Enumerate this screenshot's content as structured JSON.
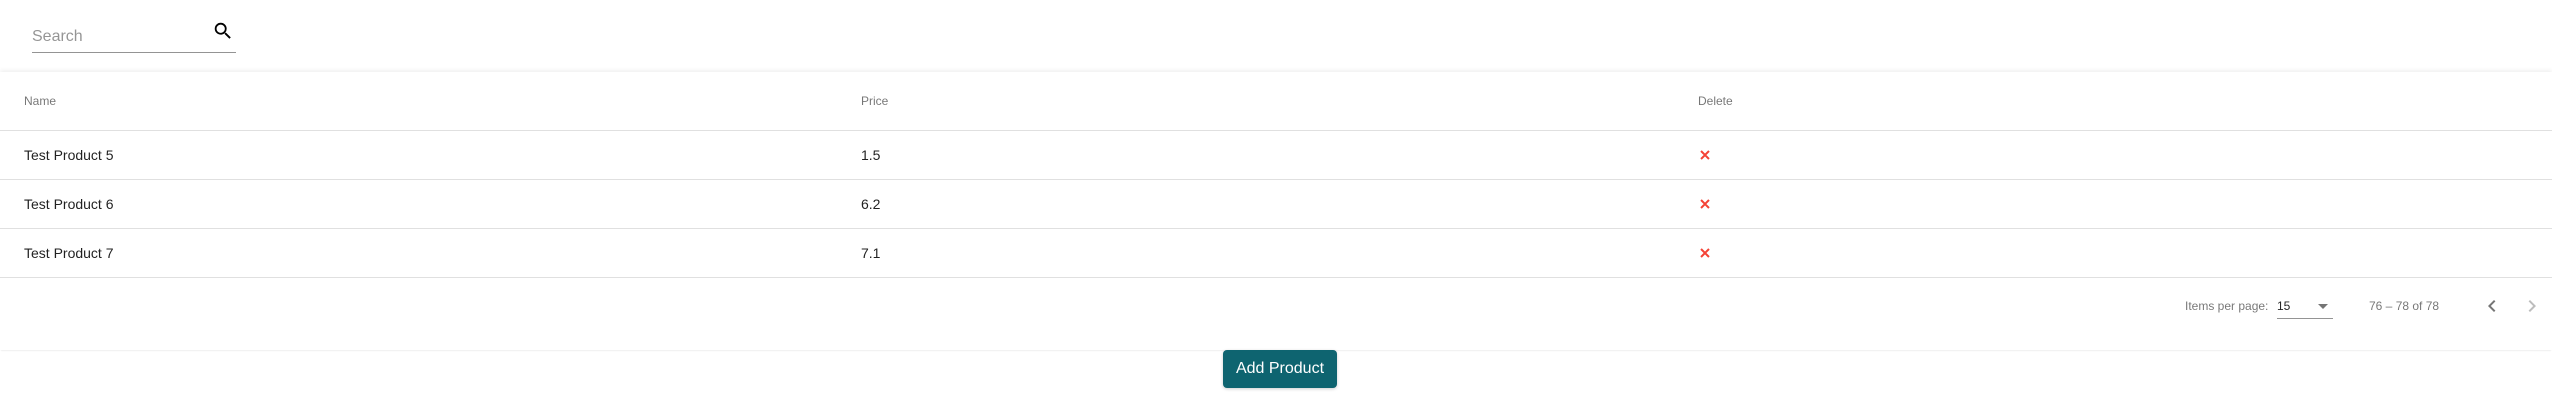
{
  "search": {
    "placeholder": "Search",
    "value": ""
  },
  "table": {
    "headers": {
      "name": "Name",
      "price": "Price",
      "delete": "Delete"
    },
    "rows": [
      {
        "name": "Test Product 5",
        "price": "1.5",
        "delete_icon": "close-icon"
      },
      {
        "name": "Test Product 6",
        "price": "6.2",
        "delete_icon": "close-icon"
      },
      {
        "name": "Test Product 7",
        "price": "7.1",
        "delete_icon": "close-icon"
      }
    ]
  },
  "paginator": {
    "items_per_page_label": "Items per page:",
    "page_size": "15",
    "range_label": "76 – 78 of 78",
    "prev_icon": "chevron-left-icon",
    "next_icon": "chevron-right-icon"
  },
  "actions": {
    "add_product_label": "Add Product"
  },
  "colors": {
    "primary": "#0e6470",
    "delete": "#f44336"
  }
}
